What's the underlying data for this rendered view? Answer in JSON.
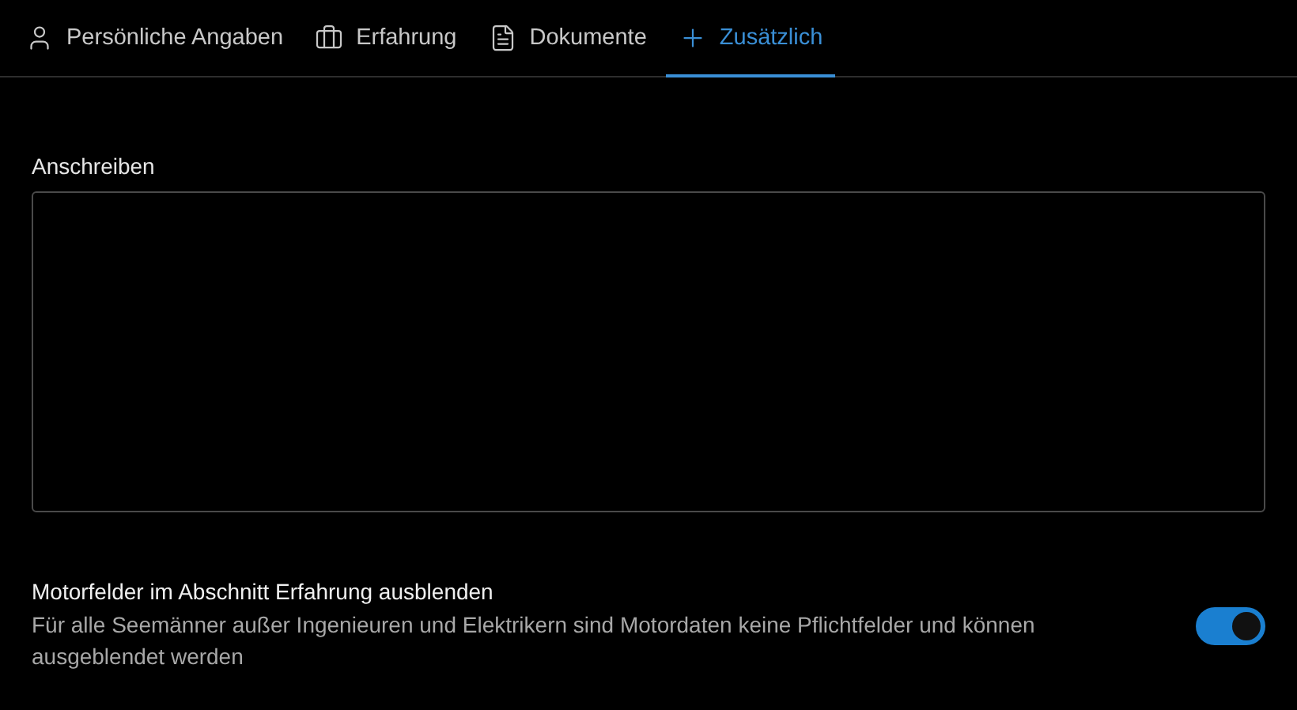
{
  "tabs": [
    {
      "label": "Persönliche Angaben",
      "selected": false
    },
    {
      "label": "Erfahrung",
      "selected": false
    },
    {
      "label": "Dokumente",
      "selected": false
    },
    {
      "label": "Zusätzlich",
      "selected": true
    }
  ],
  "cover_letter": {
    "label": "Anschreiben"
  },
  "setting": {
    "title": "Motorfelder im Abschnitt Erfahrung ausblenden",
    "description": "Für alle Seemänner außer Ingenieuren und Elektrikern sind Motordaten keine Pflichtfelder und können ausgeblendet werden",
    "on": true
  }
}
